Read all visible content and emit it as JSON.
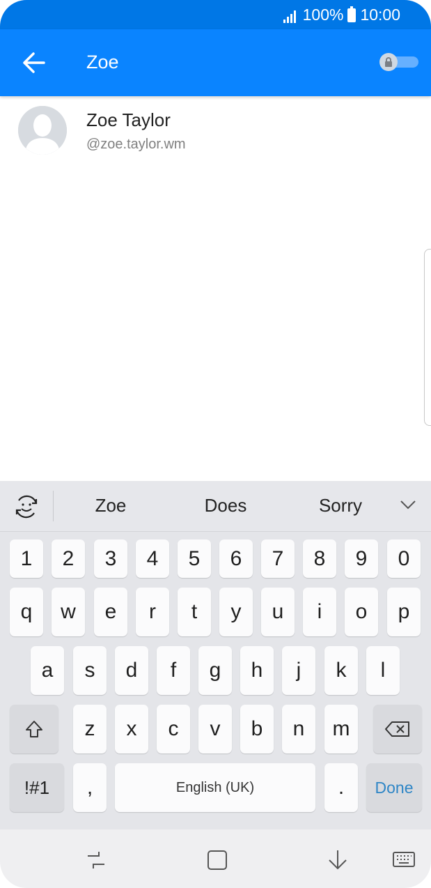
{
  "status_bar": {
    "battery": "100%",
    "time": "10:00"
  },
  "app_bar": {
    "title": "Zoe"
  },
  "result": {
    "name": "Zoe Taylor",
    "handle": "@zoe.taylor.wm"
  },
  "keyboard": {
    "suggestions": [
      "Zoe",
      "Does",
      "Sorry"
    ],
    "number_row": [
      "1",
      "2",
      "3",
      "4",
      "5",
      "6",
      "7",
      "8",
      "9",
      "0"
    ],
    "row1": [
      "q",
      "w",
      "e",
      "r",
      "t",
      "y",
      "u",
      "i",
      "o",
      "p"
    ],
    "row2": [
      "a",
      "s",
      "d",
      "f",
      "g",
      "h",
      "j",
      "k",
      "l"
    ],
    "row3": [
      "z",
      "x",
      "c",
      "v",
      "b",
      "n",
      "m"
    ],
    "symbols_label": "!#1",
    "comma": ",",
    "space_label": "English (UK)",
    "period": ".",
    "done_label": "Done"
  },
  "colors": {
    "accent": "#0a84ff",
    "status": "#0077e6",
    "done": "#2f86c6"
  }
}
